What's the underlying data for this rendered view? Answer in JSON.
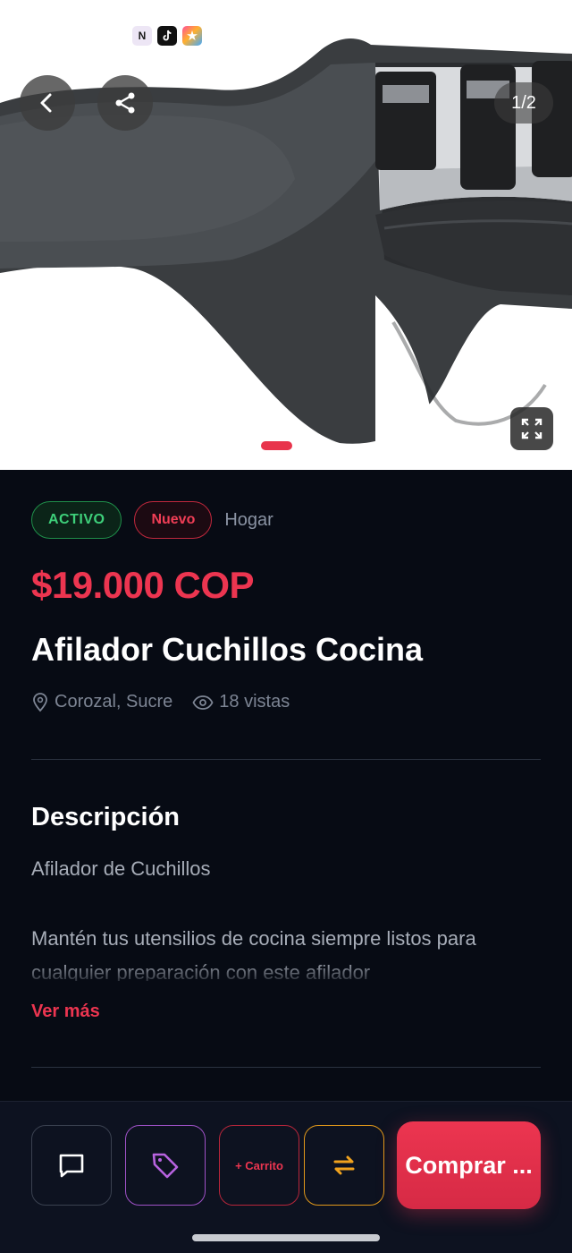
{
  "hero": {
    "image_counter": "1/2",
    "status_apps": [
      "N",
      "tiktok-app",
      "star-app"
    ],
    "icons": {
      "back": "chevron-left-icon",
      "share": "share-icon",
      "fullscreen": "expand-icon"
    }
  },
  "product": {
    "status_badge": "ACTIVO",
    "condition_badge": "Nuevo",
    "category": "Hogar",
    "price": "$19.000 COP",
    "title": "Afilador Cuchillos Cocina",
    "location": "Corozal, Sucre",
    "views": "18 vistas"
  },
  "description": {
    "heading": "Descripción",
    "first_line": "Afilador de Cuchillos",
    "body": "Mantén tus utensilios de cocina siempre listos para cualquier preparación con este afilador",
    "more_label": "Ver más"
  },
  "actions": {
    "chat_icon": "chat-icon",
    "offer_icon": "tag-icon",
    "cart_label": "+ Carrito",
    "swap_icon": "swap-icon",
    "buy_label": "Comprar ..."
  },
  "colors": {
    "accent": "#ec3550",
    "background": "#070b14",
    "active_green": "#3ed07a",
    "offer_purple": "#a052c8",
    "swap_orange": "#e2991a"
  }
}
